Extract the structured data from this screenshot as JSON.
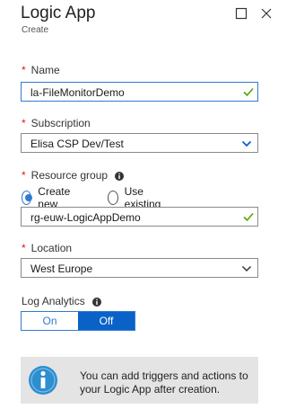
{
  "header": {
    "title": "Logic App",
    "subtitle": "Create"
  },
  "form": {
    "required_marker": "*",
    "name": {
      "label": "Name",
      "value": "la-FileMonitorDemo"
    },
    "subscription": {
      "label": "Subscription",
      "value": "Elisa CSP Dev/Test"
    },
    "resource_group": {
      "label": "Resource group",
      "create_new_label": "Create new",
      "use_existing_label": "Use existing",
      "selected_option": "Create new",
      "value": "rg-euw-LogicAppDemo"
    },
    "location": {
      "label": "Location",
      "value": "West Europe"
    },
    "log_analytics": {
      "label": "Log Analytics",
      "on_label": "On",
      "off_label": "Off",
      "selected": "Off"
    }
  },
  "info_box": {
    "message": "You can add triggers and actions to your Logic App after creation."
  },
  "icons": {
    "minimize": "maximize-square-icon",
    "close": "close-icon",
    "valid": "checkmark-icon",
    "dropdown": "chevron-down-icon",
    "info": "info-icon"
  },
  "colors": {
    "accent": "#0a62c9",
    "required": "#e81123",
    "valid": "#57a300",
    "info_circle": "#2d8fd0"
  }
}
